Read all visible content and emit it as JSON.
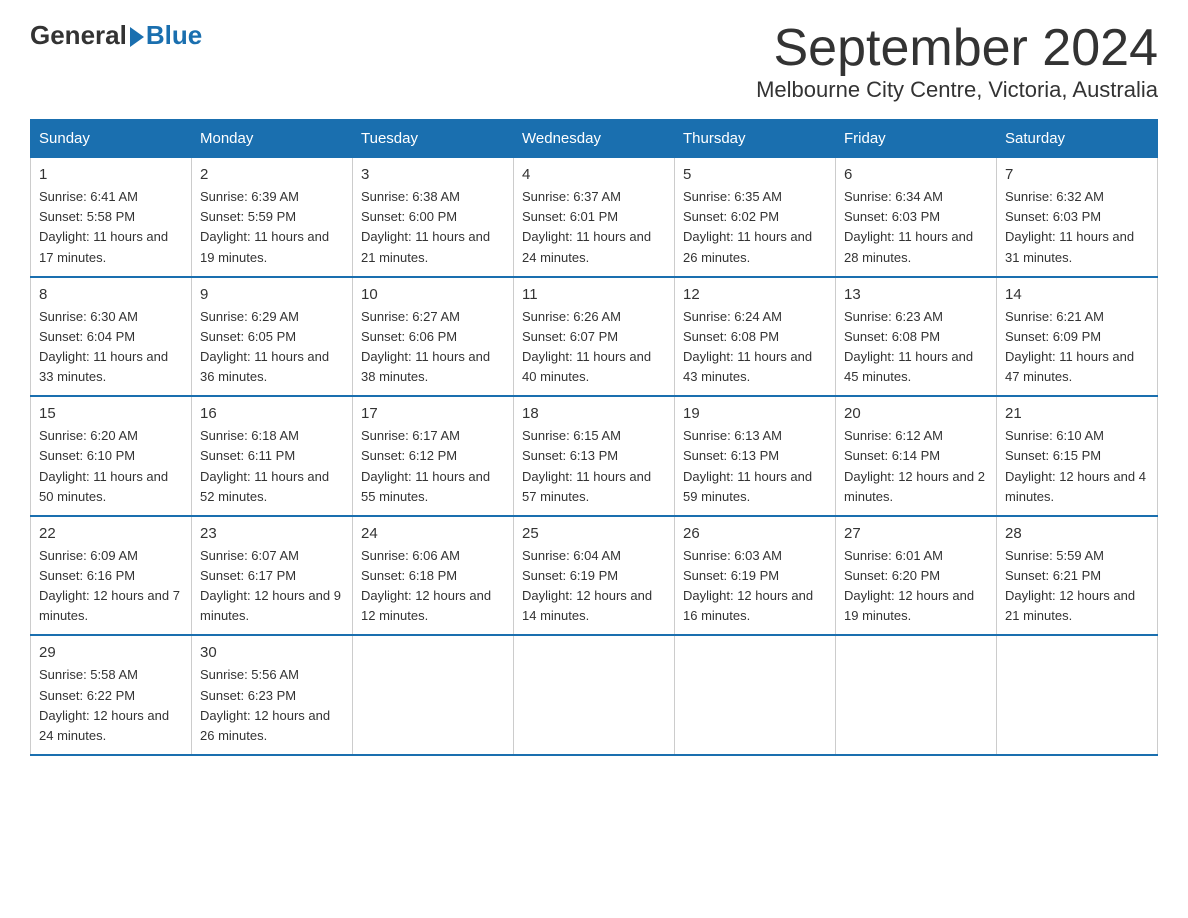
{
  "logo": {
    "general": "General",
    "blue": "Blue"
  },
  "title": "September 2024",
  "location": "Melbourne City Centre, Victoria, Australia",
  "headers": [
    "Sunday",
    "Monday",
    "Tuesday",
    "Wednesday",
    "Thursday",
    "Friday",
    "Saturday"
  ],
  "weeks": [
    [
      {
        "day": "1",
        "sunrise": "6:41 AM",
        "sunset": "5:58 PM",
        "daylight": "11 hours and 17 minutes."
      },
      {
        "day": "2",
        "sunrise": "6:39 AM",
        "sunset": "5:59 PM",
        "daylight": "11 hours and 19 minutes."
      },
      {
        "day": "3",
        "sunrise": "6:38 AM",
        "sunset": "6:00 PM",
        "daylight": "11 hours and 21 minutes."
      },
      {
        "day": "4",
        "sunrise": "6:37 AM",
        "sunset": "6:01 PM",
        "daylight": "11 hours and 24 minutes."
      },
      {
        "day": "5",
        "sunrise": "6:35 AM",
        "sunset": "6:02 PM",
        "daylight": "11 hours and 26 minutes."
      },
      {
        "day": "6",
        "sunrise": "6:34 AM",
        "sunset": "6:03 PM",
        "daylight": "11 hours and 28 minutes."
      },
      {
        "day": "7",
        "sunrise": "6:32 AM",
        "sunset": "6:03 PM",
        "daylight": "11 hours and 31 minutes."
      }
    ],
    [
      {
        "day": "8",
        "sunrise": "6:30 AM",
        "sunset": "6:04 PM",
        "daylight": "11 hours and 33 minutes."
      },
      {
        "day": "9",
        "sunrise": "6:29 AM",
        "sunset": "6:05 PM",
        "daylight": "11 hours and 36 minutes."
      },
      {
        "day": "10",
        "sunrise": "6:27 AM",
        "sunset": "6:06 PM",
        "daylight": "11 hours and 38 minutes."
      },
      {
        "day": "11",
        "sunrise": "6:26 AM",
        "sunset": "6:07 PM",
        "daylight": "11 hours and 40 minutes."
      },
      {
        "day": "12",
        "sunrise": "6:24 AM",
        "sunset": "6:08 PM",
        "daylight": "11 hours and 43 minutes."
      },
      {
        "day": "13",
        "sunrise": "6:23 AM",
        "sunset": "6:08 PM",
        "daylight": "11 hours and 45 minutes."
      },
      {
        "day": "14",
        "sunrise": "6:21 AM",
        "sunset": "6:09 PM",
        "daylight": "11 hours and 47 minutes."
      }
    ],
    [
      {
        "day": "15",
        "sunrise": "6:20 AM",
        "sunset": "6:10 PM",
        "daylight": "11 hours and 50 minutes."
      },
      {
        "day": "16",
        "sunrise": "6:18 AM",
        "sunset": "6:11 PM",
        "daylight": "11 hours and 52 minutes."
      },
      {
        "day": "17",
        "sunrise": "6:17 AM",
        "sunset": "6:12 PM",
        "daylight": "11 hours and 55 minutes."
      },
      {
        "day": "18",
        "sunrise": "6:15 AM",
        "sunset": "6:13 PM",
        "daylight": "11 hours and 57 minutes."
      },
      {
        "day": "19",
        "sunrise": "6:13 AM",
        "sunset": "6:13 PM",
        "daylight": "11 hours and 59 minutes."
      },
      {
        "day": "20",
        "sunrise": "6:12 AM",
        "sunset": "6:14 PM",
        "daylight": "12 hours and 2 minutes."
      },
      {
        "day": "21",
        "sunrise": "6:10 AM",
        "sunset": "6:15 PM",
        "daylight": "12 hours and 4 minutes."
      }
    ],
    [
      {
        "day": "22",
        "sunrise": "6:09 AM",
        "sunset": "6:16 PM",
        "daylight": "12 hours and 7 minutes."
      },
      {
        "day": "23",
        "sunrise": "6:07 AM",
        "sunset": "6:17 PM",
        "daylight": "12 hours and 9 minutes."
      },
      {
        "day": "24",
        "sunrise": "6:06 AM",
        "sunset": "6:18 PM",
        "daylight": "12 hours and 12 minutes."
      },
      {
        "day": "25",
        "sunrise": "6:04 AM",
        "sunset": "6:19 PM",
        "daylight": "12 hours and 14 minutes."
      },
      {
        "day": "26",
        "sunrise": "6:03 AM",
        "sunset": "6:19 PM",
        "daylight": "12 hours and 16 minutes."
      },
      {
        "day": "27",
        "sunrise": "6:01 AM",
        "sunset": "6:20 PM",
        "daylight": "12 hours and 19 minutes."
      },
      {
        "day": "28",
        "sunrise": "5:59 AM",
        "sunset": "6:21 PM",
        "daylight": "12 hours and 21 minutes."
      }
    ],
    [
      {
        "day": "29",
        "sunrise": "5:58 AM",
        "sunset": "6:22 PM",
        "daylight": "12 hours and 24 minutes."
      },
      {
        "day": "30",
        "sunrise": "5:56 AM",
        "sunset": "6:23 PM",
        "daylight": "12 hours and 26 minutes."
      },
      null,
      null,
      null,
      null,
      null
    ]
  ],
  "sunrise_label": "Sunrise: ",
  "sunset_label": "Sunset: ",
  "daylight_label": "Daylight: "
}
